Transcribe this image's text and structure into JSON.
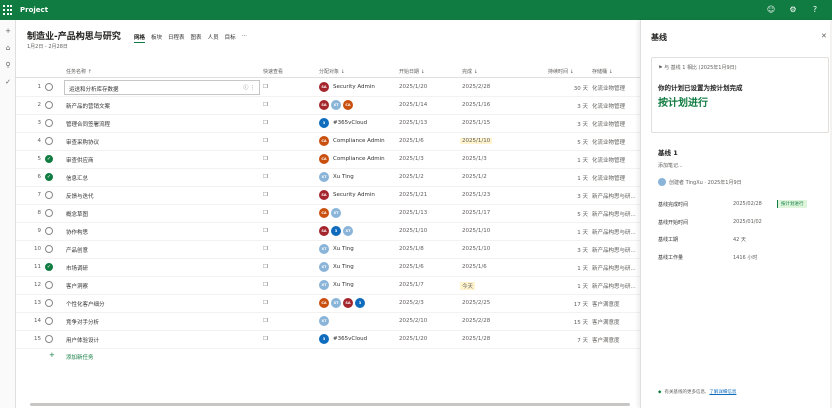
{
  "app": {
    "title": "Project"
  },
  "plan": {
    "title": "制造业-产品构思与研究",
    "dates": "1月2日 - 2月28日",
    "tabs": [
      "网格",
      "板块",
      "日程表",
      "图表",
      "人员",
      "目标"
    ],
    "more": "···"
  },
  "grid": {
    "headers": [
      "任务名称 ↑",
      "快速查看",
      "分配对象 ↓",
      "开始日期 ↓",
      "完成 ↓",
      "持续时间 ↓",
      "存储桶 ↓"
    ],
    "rows": [
      {
        "num": "1",
        "name": "运送和分析库存数据",
        "done": false,
        "assignees": [
          {
            "initials": "SA",
            "color": "#a4262c"
          }
        ],
        "assignee_text": "Security Admin",
        "start": "2025/1/20",
        "due": "2025/2/28",
        "duration": "30 天",
        "bucket": "化流业物管理",
        "due_hl": false
      },
      {
        "num": "2",
        "name": "新产品的营销文案",
        "done": false,
        "assignees": [
          {
            "initials": "SA",
            "color": "#a4262c"
          },
          {
            "initials": "XT",
            "color": "#8ab4d8"
          },
          {
            "initials": "CA",
            "color": "#ca5010"
          }
        ],
        "assignee_text": "",
        "start": "2025/1/14",
        "due": "2025/1/16",
        "duration": "3 天",
        "bucket": "化流业物管理",
        "due_hl": false
      },
      {
        "num": "3",
        "name": "管理合同签署流程",
        "done": false,
        "assignees": [
          {
            "initials": "3",
            "color": "#0f6cbd"
          }
        ],
        "assignee_text": "#365vCloud",
        "start": "2025/1/13",
        "due": "2025/1/15",
        "duration": "3 天",
        "bucket": "化流业物管理",
        "due_hl": false
      },
      {
        "num": "4",
        "name": "审查采购协议",
        "done": false,
        "assignees": [
          {
            "initials": "CA",
            "color": "#ca5010"
          }
        ],
        "assignee_text": "Compliance Admin",
        "start": "2025/1/6",
        "due": "2025/1/10",
        "duration": "5 天",
        "bucket": "化流业物管理",
        "due_hl": true
      },
      {
        "num": "5",
        "name": "审查供应商",
        "done": true,
        "assignees": [
          {
            "initials": "CA",
            "color": "#ca5010"
          }
        ],
        "assignee_text": "Compliance Admin",
        "start": "2025/1/3",
        "due": "2025/1/3",
        "duration": "1 天",
        "bucket": "化流业物管理",
        "due_hl": false
      },
      {
        "num": "6",
        "name": "信息汇总",
        "done": true,
        "assignees": [
          {
            "initials": "XT",
            "color": "#8ab4d8"
          }
        ],
        "assignee_text": "Xu Ting",
        "start": "2025/1/2",
        "due": "2025/1/2",
        "duration": "1 天",
        "bucket": "化流业物管理",
        "due_hl": false
      },
      {
        "num": "7",
        "name": "反馈与迭代",
        "done": false,
        "assignees": [
          {
            "initials": "SA",
            "color": "#a4262c"
          }
        ],
        "assignee_text": "Security Admin",
        "start": "2025/1/21",
        "due": "2025/1/23",
        "duration": "3 天",
        "bucket": "新产品构思与研...",
        "due_hl": false
      },
      {
        "num": "8",
        "name": "概念草图",
        "done": false,
        "assignees": [
          {
            "initials": "CA",
            "color": "#ca5010"
          },
          {
            "initials": "XT",
            "color": "#8ab4d8"
          }
        ],
        "assignee_text": "",
        "start": "2025/1/13",
        "due": "2025/1/17",
        "duration": "5 天",
        "bucket": "新产品构思与研...",
        "due_hl": false
      },
      {
        "num": "9",
        "name": "协作构思",
        "done": false,
        "assignees": [
          {
            "initials": "SA",
            "color": "#a4262c"
          },
          {
            "initials": "3",
            "color": "#0f6cbd"
          },
          {
            "initials": "XT",
            "color": "#8ab4d8"
          }
        ],
        "assignee_text": "",
        "start": "2025/1/10",
        "due": "2025/1/10",
        "duration": "1 天",
        "bucket": "新产品构思与研...",
        "due_hl": false
      },
      {
        "num": "10",
        "name": "产品创意",
        "done": false,
        "assignees": [
          {
            "initials": "XT",
            "color": "#8ab4d8"
          }
        ],
        "assignee_text": "Xu Ting",
        "start": "2025/1/8",
        "due": "2025/1/10",
        "duration": "3 天",
        "bucket": "新产品构思与研...",
        "due_hl": false
      },
      {
        "num": "11",
        "name": "市场调研",
        "done": true,
        "assignees": [
          {
            "initials": "XT",
            "color": "#8ab4d8"
          }
        ],
        "assignee_text": "Xu Ting",
        "start": "2025/1/6",
        "due": "2025/1/6",
        "duration": "1 天",
        "bucket": "新产品构思与研...",
        "due_hl": false
      },
      {
        "num": "12",
        "name": "客户洞察",
        "done": false,
        "assignees": [
          {
            "initials": "XT",
            "color": "#8ab4d8"
          }
        ],
        "assignee_text": "Xu Ting",
        "start": "2025/1/7",
        "due": "今天",
        "duration": "1 天",
        "bucket": "新产品构思与研...",
        "due_hl": true
      },
      {
        "num": "13",
        "name": "个性化客户细分",
        "done": false,
        "assignees": [
          {
            "initials": "CA",
            "color": "#ca5010"
          },
          {
            "initials": "XT",
            "color": "#8ab4d8"
          },
          {
            "initials": "SA",
            "color": "#a4262c"
          },
          {
            "initials": "3",
            "color": "#0f6cbd"
          }
        ],
        "assignee_text": "",
        "start": "2025/2/3",
        "due": "2025/2/25",
        "duration": "17 天",
        "bucket": "客户满意度",
        "due_hl": false
      },
      {
        "num": "14",
        "name": "竞争对手分析",
        "done": false,
        "assignees": [
          {
            "initials": "XT",
            "color": "#8ab4d8"
          }
        ],
        "assignee_text": "",
        "start": "2025/2/10",
        "due": "2025/2/28",
        "duration": "15 天",
        "bucket": "客户满意度",
        "due_hl": false
      },
      {
        "num": "15",
        "name": "用户体验设计",
        "done": false,
        "assignees": [
          {
            "initials": "3",
            "color": "#0f6cbd"
          }
        ],
        "assignee_text": "#365vCloud",
        "start": "2025/1/20",
        "due": "2025/1/28",
        "duration": "7 天",
        "bucket": "客户满意度",
        "due_hl": false
      }
    ],
    "add_task": "添加新任务"
  },
  "panel": {
    "title": "基线",
    "compare": "与 基线 1 相比 (2025年1月9日)",
    "desc": "你的计划已设置为按计划完成",
    "status": "按计划进行",
    "baseline_name": "基线 1",
    "note": "添加笔记...",
    "creator": "创建者 TingXu · 2025年1月9日",
    "fields": [
      {
        "label": "基线完成时间",
        "value": "2025/02/28"
      },
      {
        "label": "基线开始时间",
        "value": "2025/01/02"
      },
      {
        "label": "基线工期",
        "value": "42 天"
      },
      {
        "label": "基线工作量",
        "value": "1416 小时"
      }
    ],
    "badge": "按计划进行",
    "footer_text": "有关基线的更多信息,",
    "footer_link": "了解详细信息"
  },
  "colors": {
    "brand": "#107c41"
  }
}
